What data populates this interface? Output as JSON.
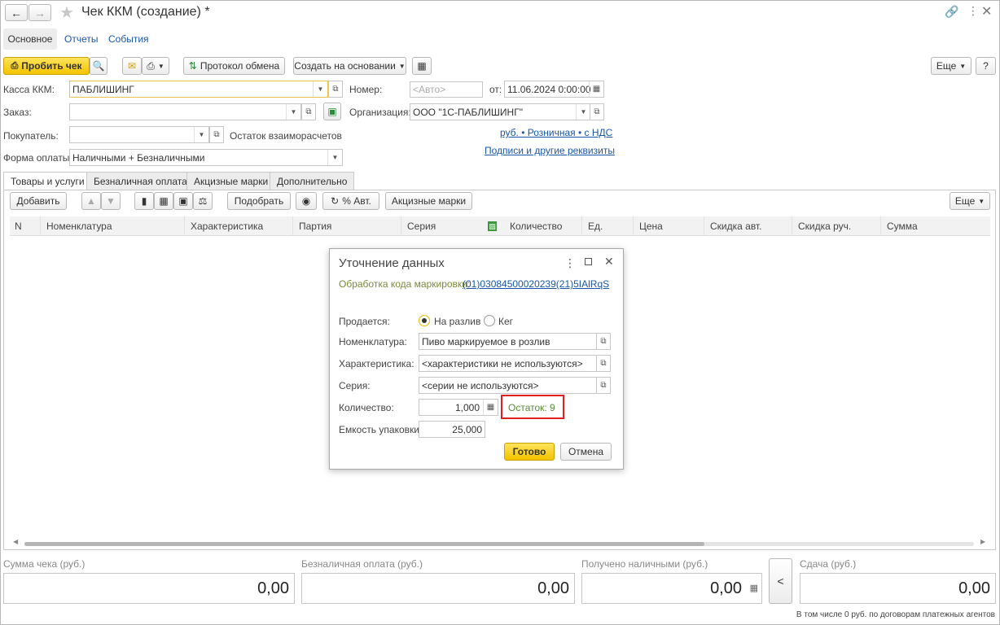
{
  "window": {
    "title": "Чек ККМ (создание) *"
  },
  "nav_tabs": [
    "Основное",
    "Отчеты",
    "События"
  ],
  "toolbar": {
    "punch_check": "Пробить чек",
    "exchange_protocol": "Протокол обмена",
    "create_based_on": "Создать на основании",
    "more": "Еще",
    "help": "?"
  },
  "form": {
    "kassa_label": "Касса ККМ:",
    "kassa_value": "ПАБЛИШИНГ",
    "nomer_label": "Номер:",
    "nomer_placeholder": "<Авто>",
    "ot_label": "от:",
    "date_value": "11.06.2024  0:00:00",
    "zakaz_label": "Заказ:",
    "org_label": "Организация:",
    "org_value": "ООО \"1С-ПАБЛИШИНГ\"",
    "buyer_label": "Покупатель:",
    "balance_label": "Остаток взаиморасчетов",
    "price_link": "руб. • Розничная • с НДС",
    "payform_label": "Форма оплаты:",
    "payform_value": "Наличными + Безналичными",
    "signatures_link": "Подписи и другие реквизиты"
  },
  "tabs": [
    "Товары и услуги",
    "Безналичная оплата",
    "Акцизные марки",
    "Дополнительно"
  ],
  "table_toolbar": {
    "add": "Добавить",
    "pick": "Подобрать",
    "auto_pct": "% Авт.",
    "excise": "Акцизные марки",
    "more": "Еще"
  },
  "columns": [
    "N",
    "Номенклатура",
    "Характеристика",
    "Партия",
    "Серия",
    "Количество",
    "Ед.",
    "Цена",
    "Скидка авт.",
    "Скидка руч.",
    "Сумма"
  ],
  "totals": {
    "sum_label": "Сумма чека (руб.)",
    "sum_value": "0,00",
    "cashless_label": "Безналичная оплата (руб.)",
    "cashless_value": "0,00",
    "cash_label": "Получено наличными (руб.)",
    "cash_value": "0,00",
    "back_btn": "<",
    "change_label": "Сдача (руб.)",
    "change_value": "0,00",
    "footnote": "В том числе 0 руб. по договорам платежных агентов"
  },
  "dialog": {
    "title": "Уточнение данных",
    "marking_label": "Обработка кода маркировки:",
    "marking_code": "(01)03084500020239(21)5IAlRqS",
    "sold_label": "Продается:",
    "opt_draft": "На разлив",
    "opt_keg": "Кег",
    "nom_label": "Номенклатура:",
    "nom_value": "Пиво маркируемое в розлив",
    "char_label": "Характеристика:",
    "char_value": "<характеристики не используются>",
    "series_label": "Серия:",
    "series_value": "<серии не используются>",
    "qty_label": "Количество:",
    "qty_value": "1,000",
    "stock": "Остаток: 9",
    "pack_label": "Емкость упаковки:",
    "pack_value": "25,000",
    "ok": "Готово",
    "cancel": "Отмена"
  },
  "colors": {
    "accent_yellow": "#f2c300",
    "link": "#1a57a8",
    "stock_green": "#5a8a3a",
    "highlight_red": "#e02020"
  }
}
